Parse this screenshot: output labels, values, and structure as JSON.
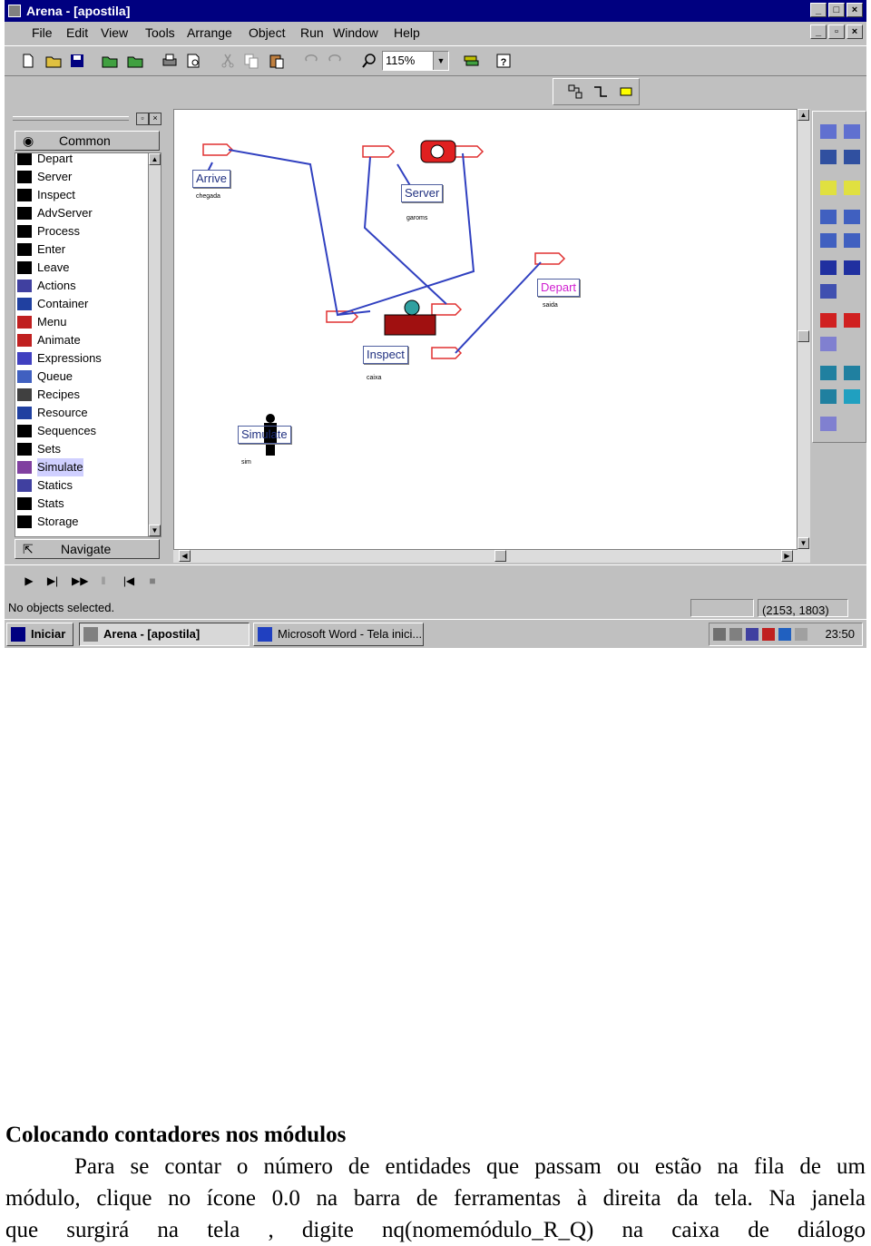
{
  "window": {
    "title": "Arena - [apostila]",
    "menu": [
      "File",
      "Edit",
      "View",
      "Tools",
      "Arrange",
      "Object",
      "Run",
      "Window",
      "Help"
    ],
    "zoom": "115%"
  },
  "template_panel": {
    "header": "Common",
    "items": [
      "Depart",
      "Server",
      "Inspect",
      "AdvServer",
      "Process",
      "Enter",
      "Leave",
      "Actions",
      "Container",
      "Menu",
      "Animate",
      "Expressions",
      "Queue",
      "Recipes",
      "Resource",
      "Sequences",
      "Sets",
      "Simulate",
      "Statics",
      "Stats",
      "Storage"
    ],
    "selected": "Simulate",
    "footer": "Navigate"
  },
  "canvas": {
    "modules": {
      "arrive": {
        "label": "Arrive",
        "caption": "chegada"
      },
      "server": {
        "label": "Server",
        "caption": "garoms"
      },
      "depart": {
        "label": "Depart",
        "caption": "saida"
      },
      "inspect": {
        "label": "Inspect",
        "caption": "caixa"
      },
      "simulate": {
        "label": "Simulate",
        "caption": "sim"
      }
    }
  },
  "status": {
    "message": "No objects selected.",
    "coords": "(2153, 1803)"
  },
  "taskbar": {
    "start": "Iniciar",
    "tasks": [
      "Arena - [apostila]",
      "Microsoft Word - Tela inici..."
    ],
    "time": "23:50"
  },
  "document": {
    "heading": "Colocando contadores nos módulos",
    "lines": [
      "Para se contar o número de entidades que passam ou estão na fila de um",
      "módulo, clique no ícone 0.0 na barra de ferramentas à direita da tela. Na janela",
      "que surgirá na tela , digite nq(nomemódulo_R_Q) na caixa de diálogo"
    ]
  },
  "colors": {
    "title_bar": "#000080",
    "chrome": "#c0c0c0",
    "link_line": "#3040c0",
    "queue_red": "#e03030",
    "depart_magenta": "#d020d0"
  },
  "icons": [
    "app-icon",
    "new-icon",
    "open-icon",
    "save-icon",
    "print-icon",
    "zoom-icon",
    "play-icon",
    "stop-icon",
    "start-icon",
    "speaker-icon"
  ]
}
